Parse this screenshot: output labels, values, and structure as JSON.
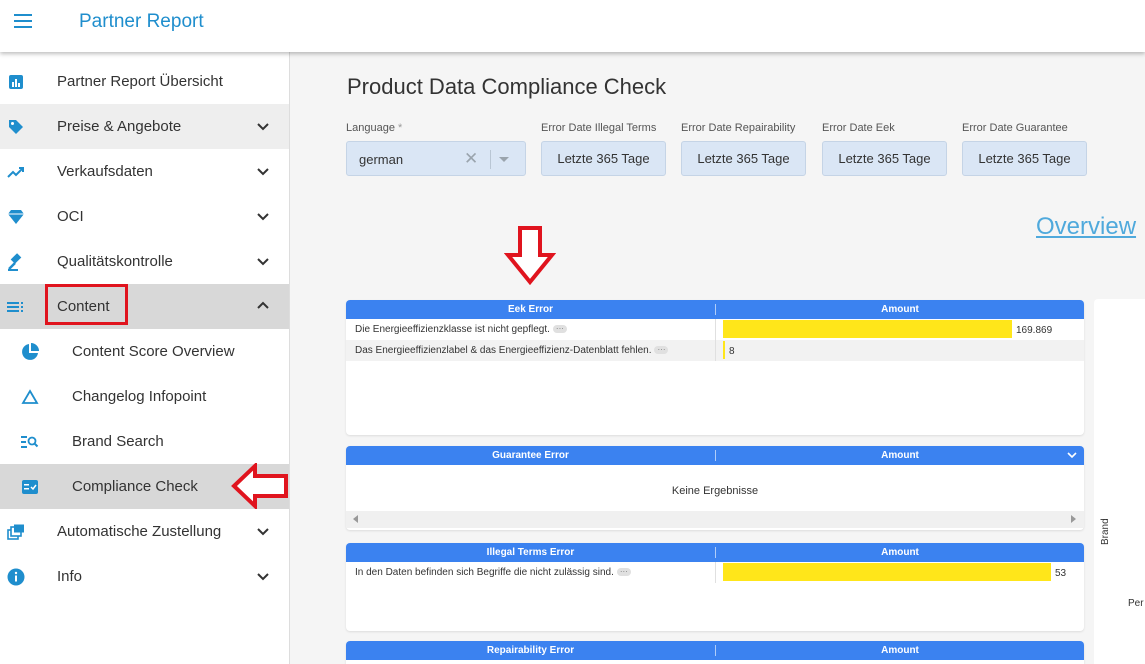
{
  "app": {
    "title": "Partner Report"
  },
  "sidebar": {
    "items": [
      {
        "label": "Partner Report Übersicht",
        "icon": "bar-chart-icon"
      },
      {
        "label": "Preise & Angebote",
        "icon": "tag-icon"
      },
      {
        "label": "Verkaufsdaten",
        "icon": "trending-up-icon"
      },
      {
        "label": "OCI",
        "icon": "diamond-icon"
      },
      {
        "label": "Qualitätskontrolle",
        "icon": "gavel-icon"
      },
      {
        "label": "Content",
        "icon": "list-icon"
      },
      {
        "label": "Content Score Overview",
        "icon": "pie-chart-icon"
      },
      {
        "label": "Changelog Infopoint",
        "icon": "triangle-icon"
      },
      {
        "label": "Brand Search",
        "icon": "list-search-icon"
      },
      {
        "label": "Compliance Check",
        "icon": "checklist-icon"
      },
      {
        "label": "Automatische Zustellung",
        "icon": "layers-icon"
      },
      {
        "label": "Info",
        "icon": "info-icon"
      }
    ]
  },
  "main": {
    "title": "Product Data Compliance Check",
    "filters": {
      "language": {
        "label": "Language",
        "required_mark": "*",
        "value": "german"
      },
      "illegal_terms": {
        "label": "Error Date Illegal Terms",
        "value": "Letzte 365 Tage"
      },
      "repairability": {
        "label": "Error Date Repairability",
        "value": "Letzte 365 Tage"
      },
      "eek": {
        "label": "Error Date Eek",
        "value": "Letzte 365 Tage"
      },
      "guarantee": {
        "label": "Error Date Guarantee",
        "value": "Letzte 365 Tage"
      }
    },
    "overview_link": "Overview",
    "tables": {
      "eek": {
        "header": "Eek Error",
        "amount_header": "Amount",
        "rows": [
          {
            "text": "Die Energieeffizienzklasse ist nicht gepflegt.",
            "amount": "169.869",
            "value": 169869
          },
          {
            "text": "Das Energieeffizienzlabel & das Energieeffizienz-Datenblatt fehlen.",
            "amount": "8",
            "value": 8
          }
        ]
      },
      "guarantee": {
        "header": "Guarantee Error",
        "amount_header": "Amount",
        "empty_text": "Keine Ergebnisse"
      },
      "illegal": {
        "header": "Illegal Terms Error",
        "amount_header": "Amount",
        "rows": [
          {
            "text": "In den Daten befinden sich Begriffe die nicht zulässig sind.",
            "amount": "53",
            "value": 53
          }
        ]
      },
      "repairability": {
        "header": "Repairability Error",
        "amount_header": "Amount"
      }
    },
    "side_chart": {
      "axis_label": "Brand",
      "partial_label": "Per"
    },
    "ellipsis": "···"
  },
  "colors": {
    "accent": "#1f8ecd",
    "table_header": "#3b82f0",
    "bar": "#ffe61a",
    "highlight": "#e0141e"
  }
}
